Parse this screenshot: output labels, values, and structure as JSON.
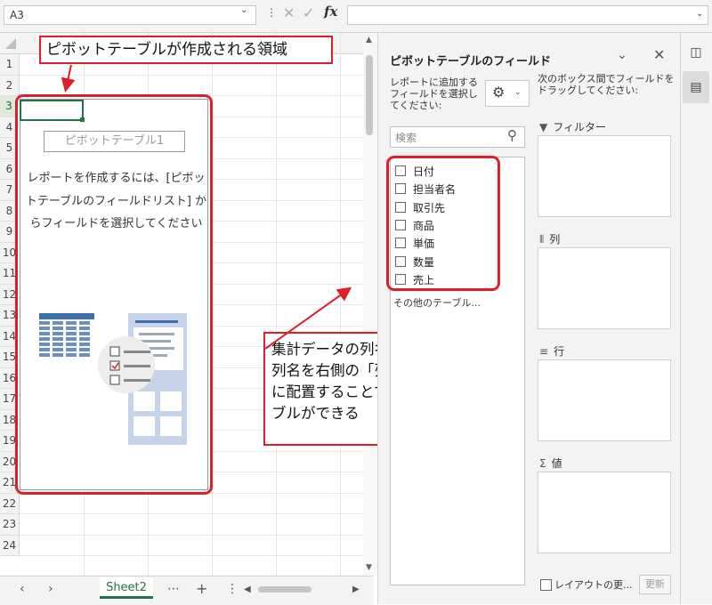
{
  "formula_bar": {
    "name_box": "A3",
    "dropdown_glyph": "⌄",
    "dots_glyph": "⋮",
    "cancel_glyph": "✕",
    "enter_glyph": "✓",
    "fx_label": "fx",
    "formula_value": "",
    "formula_dropdown_glyph": "⌄"
  },
  "grid": {
    "row_numbers": [
      "1",
      "2",
      "3",
      "4",
      "5",
      "6",
      "7",
      "8",
      "9",
      "10",
      "11",
      "12",
      "13",
      "14",
      "15",
      "16",
      "17",
      "18",
      "19",
      "20",
      "21",
      "22",
      "23",
      "24"
    ],
    "selected_row": "3",
    "scroll_up_glyph": "▲",
    "scroll_down_glyph": "▼"
  },
  "sheet_tabs": {
    "prev_glyph": "‹",
    "next_glyph": "›",
    "active_sheet": "Sheet2",
    "more_glyph": "⋯",
    "add_glyph": "+",
    "menu_glyph": "⋮",
    "scroll_left_glyph": "◀",
    "scroll_right_glyph": "▶"
  },
  "pivot_placeholder": {
    "name": "ピボットテーブル1",
    "message": "レポートを作成するには、[ピボットテーブルのフィールドリスト] からフィールドを選択してください"
  },
  "callouts": {
    "top": "ピボットテーブルが作成される領域",
    "bottom_right": [
      "集計データの列名",
      "列名を右側の「列」「行」「値」",
      "に配置することでピボットテー",
      "ブルができる"
    ]
  },
  "field_pane": {
    "title": "ピボットテーブルのフィールド",
    "chevron_glyph": "⌄",
    "close_glyph": "✕",
    "add_label": "レポートに追加するフィールドを選択してください:",
    "gear_glyph": "⚙",
    "gear_arrow_glyph": "⌄",
    "drag_label": "次のボックス間でフィールドをドラッグしてください:",
    "search_placeholder": "検索",
    "search_glyph": "⚲",
    "fields": [
      "日付",
      "担当者名",
      "取引先",
      "商品",
      "単価",
      "数量",
      "売上"
    ],
    "more_tables": "その他のテーブル...",
    "zones": [
      {
        "icon": "▼",
        "label": "フィルター"
      },
      {
        "icon": "⦀",
        "label": "列"
      },
      {
        "icon": "≡",
        "label": "行"
      },
      {
        "icon": "Σ",
        "label": "値"
      }
    ],
    "defer_label": "レイアウトの更...",
    "update_button": "更新"
  },
  "right_strip": {
    "icon1_glyph": "◫",
    "icon2_glyph": "▤"
  },
  "colors": {
    "accent_green": "#217346",
    "callout_red": "#e01e2a"
  }
}
